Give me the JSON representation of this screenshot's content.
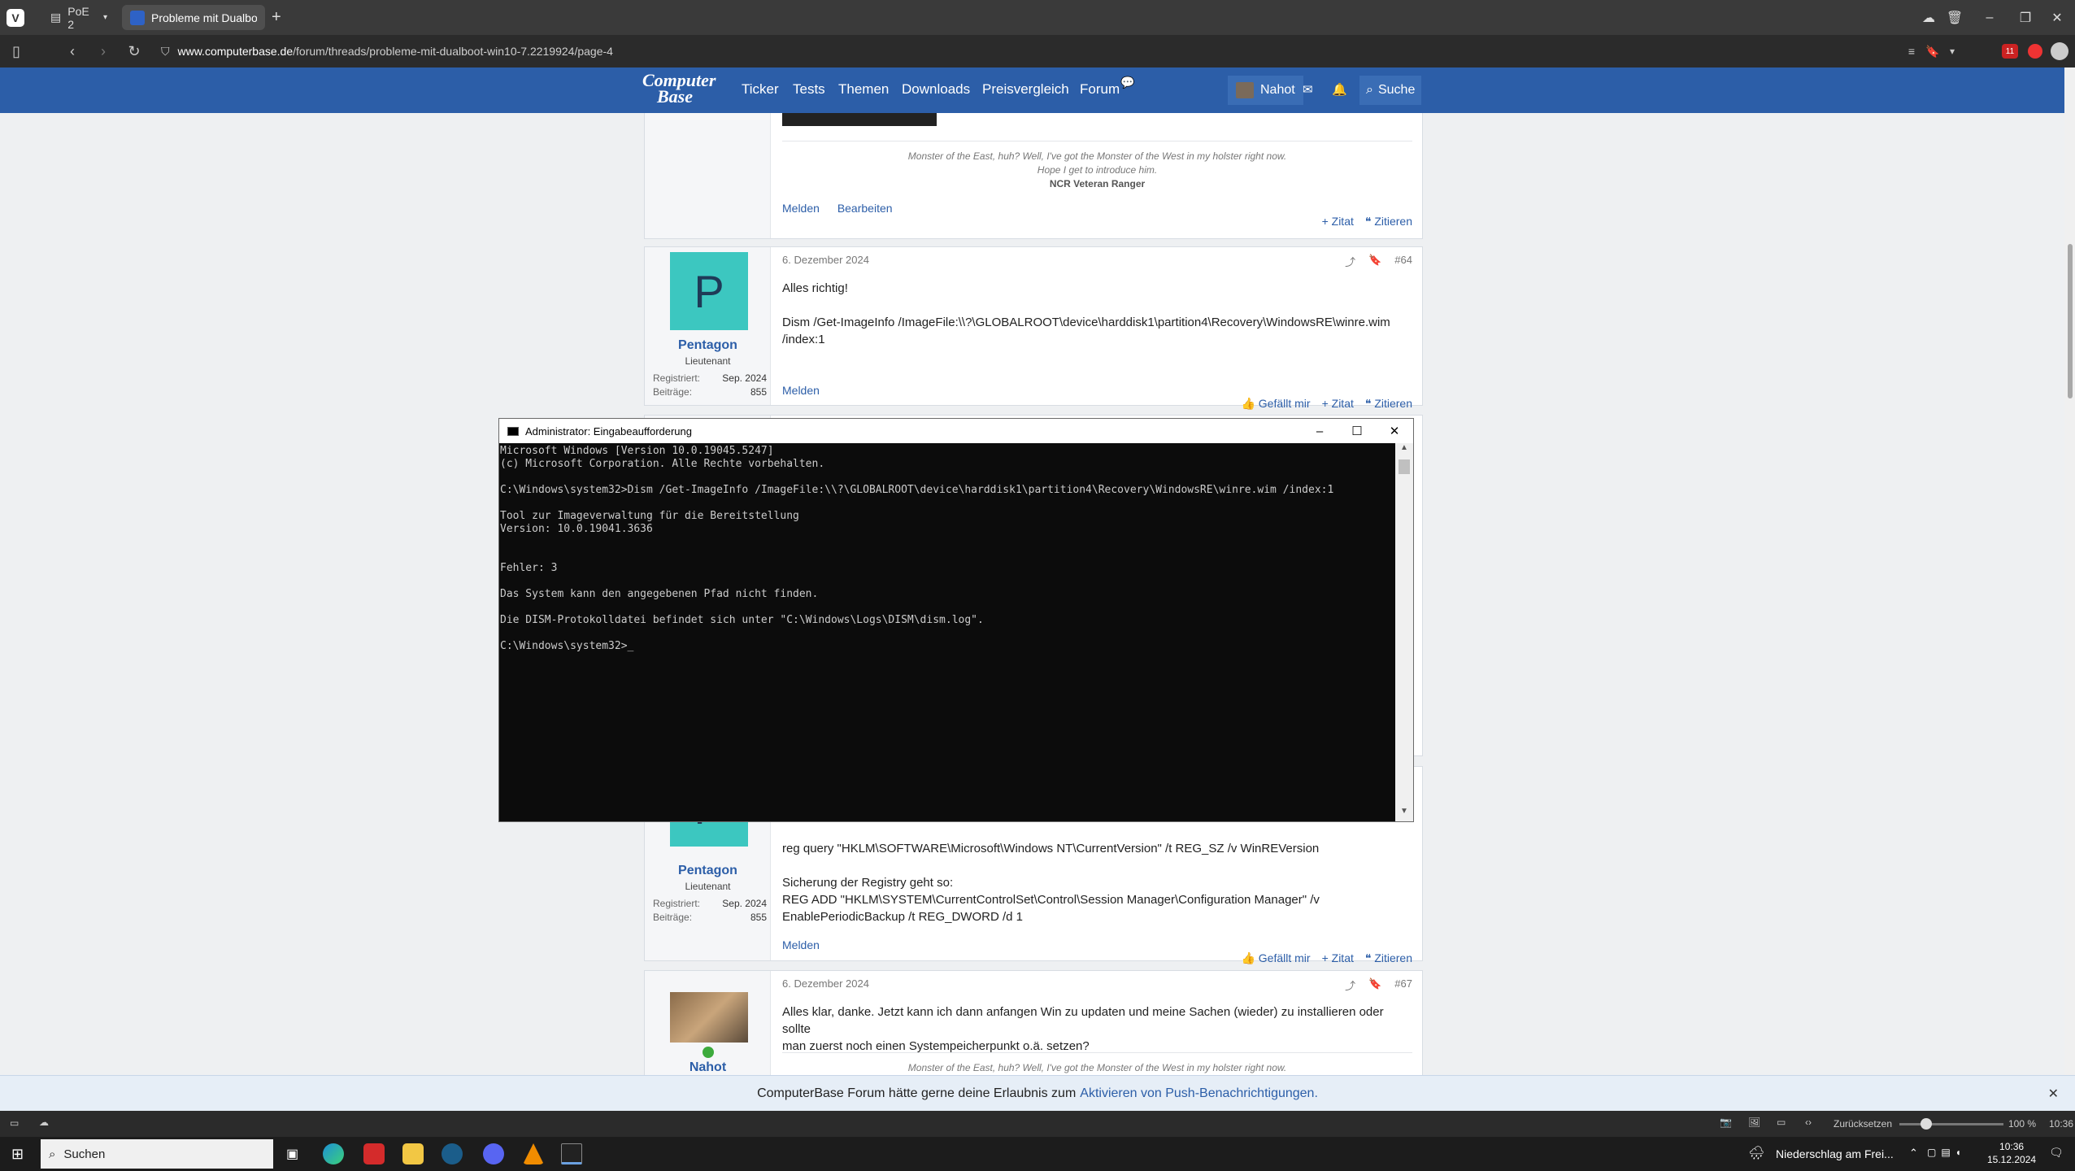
{
  "browser": {
    "tabs": [
      {
        "label": "PoE 2"
      },
      {
        "label": "Probleme mit Dualboot Wi"
      }
    ],
    "url_domain": "www.computerbase.de",
    "url_path": "/forum/threads/probleme-mit-dualboot-win10-7.2219924/page-4",
    "badge_count": "11"
  },
  "site": {
    "logo_top": "Computer",
    "logo_bottom": "Base",
    "nav": [
      "Ticker",
      "Tests",
      "Themen",
      "Downloads",
      "Preisvergleich",
      "Forum"
    ],
    "username": "Nahot",
    "search_label": "Suche"
  },
  "posts": {
    "p63": {
      "signature_line1": "Monster of the East, huh? Well, I've got the Monster of the West in my holster right now.",
      "signature_line2": "Hope I get to introduce him.",
      "signature_line3": "NCR Veteran Ranger",
      "melden": "Melden",
      "bearbeiten": "Bearbeiten",
      "zitat": "+ Zitat",
      "zitieren": "Zitieren"
    },
    "p64": {
      "avatar_letter": "P",
      "username": "Pentagon",
      "rank": "Lieutenant",
      "registered_label": "Registriert:",
      "registered": "Sep. 2024",
      "posts_label": "Beiträge:",
      "posts": "855",
      "date": "6. Dezember 2024",
      "number": "#64",
      "line1": "Alles richtig!",
      "line2": "Dism /Get-ImageInfo /ImageFile:\\\\?\\GLOBALROOT\\device\\harddisk1\\partition4\\Recovery\\WindowsRE\\winre.wim",
      "line3": "/index:1",
      "melden": "Melden",
      "like": "Gefällt mir",
      "zitat": "+ Zitat",
      "zitieren": "Zitieren"
    },
    "p66": {
      "avatar_letter": "P",
      "username": "Pentagon",
      "rank": "Lieutenant",
      "registered_label": "Registriert:",
      "registered": "Sep. 2024",
      "posts_label": "Beiträge:",
      "posts": "855",
      "line1": "reg query \"HKLM\\SOFTWARE\\Microsoft\\Windows NT\\CurrentVersion\" /t REG_SZ /v WinREVersion",
      "line2": "Sicherung der Registry geht so:",
      "line3": "REG ADD \"HKLM\\SYSTEM\\CurrentControlSet\\Control\\Session Manager\\Configuration Manager\" /v",
      "line4": "EnablePeriodicBackup /t REG_DWORD /d 1",
      "melden": "Melden",
      "like": "Gefällt mir",
      "zitat": "+ Zitat",
      "zitieren": "Zitieren"
    },
    "p67": {
      "username": "Nahot",
      "date": "6. Dezember 2024",
      "number": "#67",
      "line1": "Alles klar, danke. Jetzt kann ich dann anfangen Win zu updaten und meine Sachen (wieder) zu installieren oder sollte",
      "line2": "man zuerst noch einen Systempeicherpunkt o.ä. setzen?",
      "signature_line1": "Monster of the East, huh? Well, I've got the Monster of the West in my holster right now."
    }
  },
  "cmd": {
    "title": "Administrator: Eingabeaufforderung",
    "output": "Microsoft Windows [Version 10.0.19045.5247]\n(c) Microsoft Corporation. Alle Rechte vorbehalten.\n\nC:\\Windows\\system32>Dism /Get-ImageInfo /ImageFile:\\\\?\\GLOBALROOT\\device\\harddisk1\\partition4\\Recovery\\WindowsRE\\winre.wim /index:1\n\nTool zur Imageverwaltung für die Bereitstellung\nVersion: 10.0.19041.3636\n\n\nFehler: 3\n\nDas System kann den angegebenen Pfad nicht finden.\n\nDie DISM-Protokolldatei befindet sich unter \"C:\\Windows\\Logs\\DISM\\dism.log\".\n\nC:\\Windows\\system32>_"
  },
  "notification": {
    "text": "ComputerBase Forum hätte gerne deine Erlaubnis zum",
    "link": "Aktivieren von Push-Benachrichtigungen."
  },
  "statusbar": {
    "reset_label": "Zurücksetzen",
    "zoom": "100 %",
    "time": "10:36"
  },
  "taskbar": {
    "search_placeholder": "Suchen",
    "weather": "Niederschlag am Frei...",
    "time": "10:36",
    "date": "15.12.2024"
  },
  "colors": {
    "site_blue": "#2c5ea8",
    "avatar_teal": "#3cc7c0"
  }
}
